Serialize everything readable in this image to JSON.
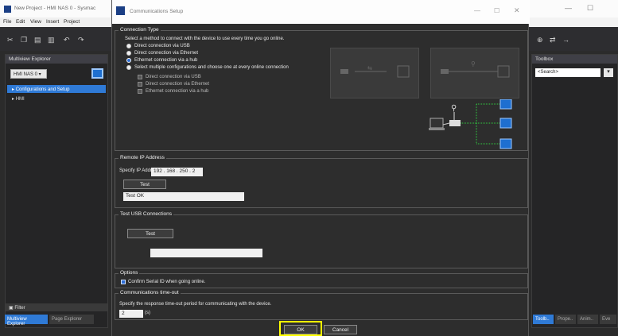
{
  "background_app": {
    "title": "New Project - HMI NAS 0 - Sysmac",
    "menu": [
      "File",
      "Edit",
      "View",
      "Insert",
      "Project"
    ],
    "left_panel": {
      "header": "Multiview Explorer",
      "device": "HMI NAS 0",
      "tree": [
        "Configurations and Setup",
        "HMI"
      ],
      "filter": "Filter",
      "tabs": [
        "Multiview Explorer",
        "Page Explorer"
      ]
    },
    "right_panel": {
      "header": "Toolbox",
      "search_placeholder": "<Search>",
      "tabs": [
        "Toolb..",
        "Prope..",
        "Anim..",
        "Eve"
      ]
    }
  },
  "dialog": {
    "title": "Communications Setup",
    "connection_type": {
      "title": "Connection Type",
      "instruction": "Select a method to connect with the device to use every time you go online.",
      "options": [
        {
          "label": "Direct connection via USB",
          "selected": false
        },
        {
          "label": "Direct connection via Ethernet",
          "selected": false
        },
        {
          "label": "Ethernet connection via a hub",
          "selected": true
        },
        {
          "label": "Select multiple configurations and choose one at every online connection",
          "selected": false
        }
      ],
      "sub_options": [
        "Direct connection via USB",
        "Direct connection via Ethernet",
        "Ethernet connection via a hub"
      ]
    },
    "remote_ip": {
      "title": "Remote IP Address",
      "label": "Specify IP Address",
      "ip": "192 . 168 . 250 . 2",
      "test_button": "Test",
      "result": "Test OK"
    },
    "usb_test": {
      "title": "Test USB Connections",
      "test_button": "Test",
      "result": ""
    },
    "options": {
      "title": "Options",
      "confirm_serial": "Confirm Serial ID when going online.",
      "confirm_serial_checked": true
    },
    "timeout": {
      "title": "Communications time-out",
      "instruction": "Specify the response time-out period for communicating with the device.",
      "value": "2",
      "unit": "(s)"
    },
    "ok_button": "OK",
    "cancel_button": "Cancel"
  },
  "colors": {
    "accent": "#2f7ad6",
    "ok_highlight": "#ffff00",
    "device_screen": "#1e6fd0"
  }
}
